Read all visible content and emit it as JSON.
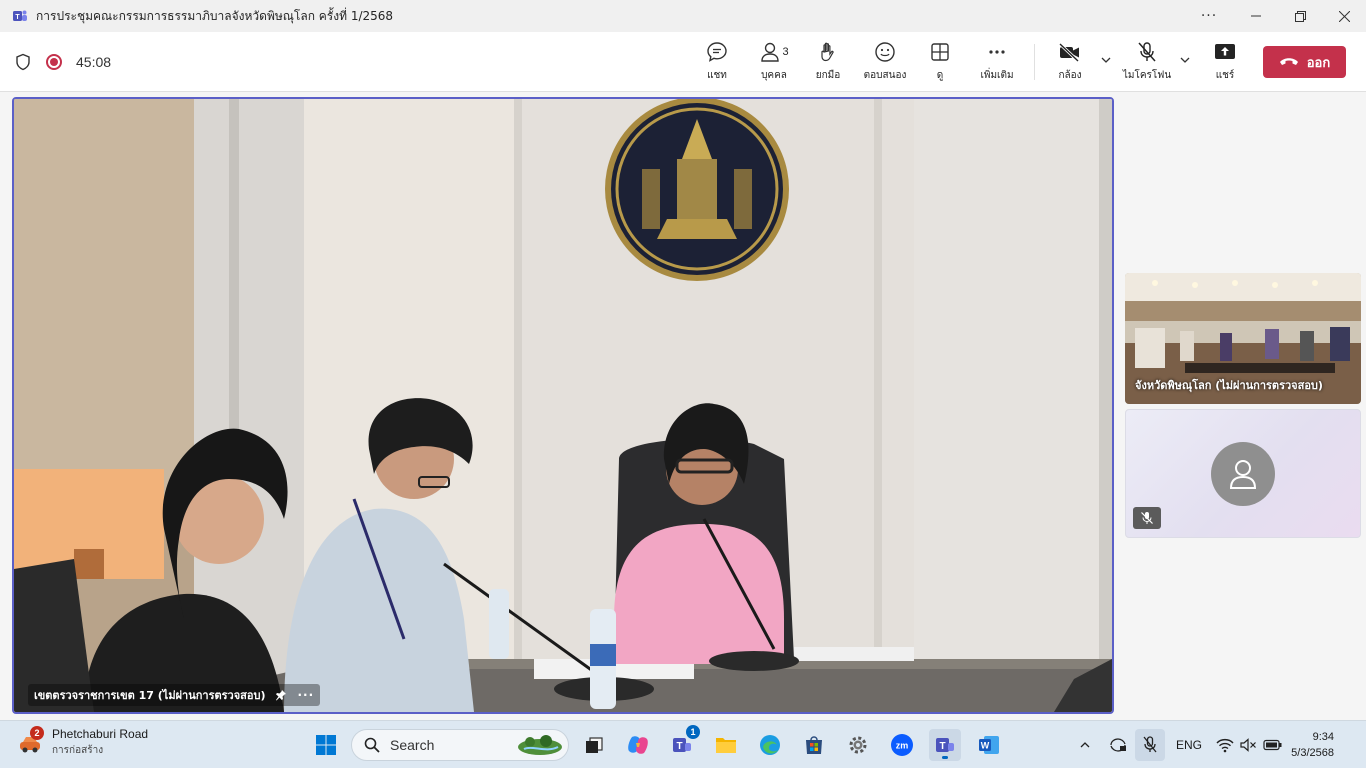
{
  "window": {
    "title": "การประชุมคณะกรรมการธรรมาภิบาลจังหวัดพิษณุโลก ครั้งที่ 1/2568",
    "controls": [
      "more",
      "minimize",
      "restore",
      "close"
    ]
  },
  "meeting": {
    "timer": "45:08",
    "buttons": {
      "chat": "แชท",
      "people": "บุคคล",
      "people_count": "3",
      "raise_hand": "ยกมือ",
      "react": "ตอบสนอง",
      "view": "ดู",
      "more": "เพิ่มเติม",
      "camera": "กล้อง",
      "mic": "ไมโครโฟน",
      "share": "แชร์",
      "leave": "ออก"
    },
    "colors": {
      "accent": "#5b5fc7",
      "leave": "#c4314b"
    }
  },
  "stage": {
    "participant_name": "เขตตรวจราชการเขต 17 (ไม่ผ่านการตรวจสอบ)"
  },
  "side_tiles": [
    {
      "name": "จังหวัดพิษณุโลก (ไม่ผ่านการตรวจสอบ)"
    },
    {
      "name": "",
      "muted": true
    }
  ],
  "taskbar": {
    "weather": {
      "title": "Phetchaburi Road",
      "subtitle": "การก่อสร้าง",
      "badge": "2"
    },
    "search_label": "Search",
    "teams_badge": "1",
    "language": "ENG",
    "time": "9:34",
    "date": "5/3/2568",
    "apps": [
      "windows-start",
      "search",
      "task-view",
      "copilot",
      "teams",
      "file-explorer",
      "edge",
      "store",
      "settings",
      "zoom",
      "teams-active",
      "word"
    ]
  }
}
